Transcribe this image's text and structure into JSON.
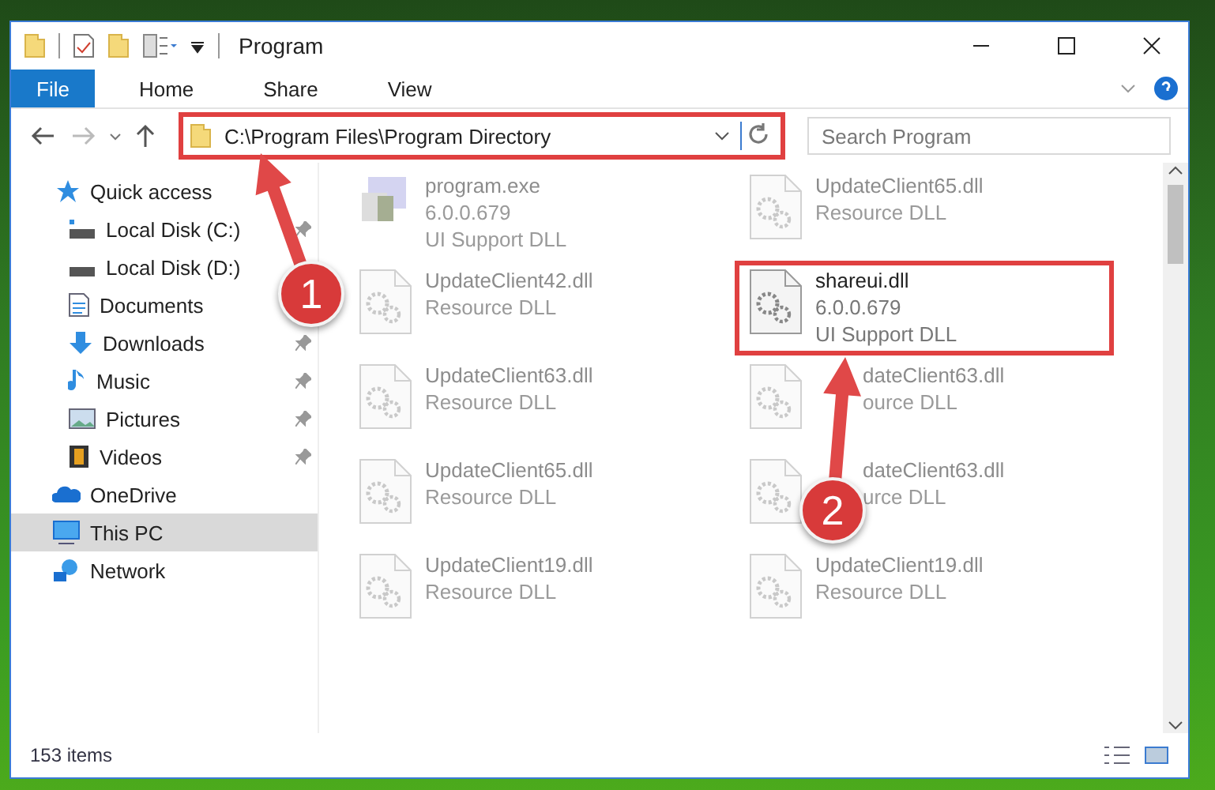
{
  "window": {
    "title": "Program"
  },
  "ribbon_tabs": [
    {
      "label": "File",
      "selected": true
    },
    {
      "label": "Home",
      "selected": false
    },
    {
      "label": "Share",
      "selected": false
    },
    {
      "label": "View",
      "selected": false
    }
  ],
  "address": {
    "value": "C:\\Program Files\\Program Directory",
    "highlighted": true
  },
  "search": {
    "placeholder": "Search Program"
  },
  "sidebar": {
    "items": [
      {
        "label": "Quick access",
        "selected": false,
        "children": [
          {
            "label": "Local Disk (C:)",
            "pinned": true
          },
          {
            "label": "Local Disk (D:)",
            "pinned": false
          },
          {
            "label": "Documents",
            "pinned": false
          },
          {
            "label": "Downloads",
            "pinned": true
          },
          {
            "label": "Music",
            "pinned": true
          },
          {
            "label": "Pictures",
            "pinned": true
          },
          {
            "label": "Videos",
            "pinned": true
          }
        ]
      },
      {
        "label": "OneDrive",
        "selected": false
      },
      {
        "label": "This PC",
        "selected": true
      },
      {
        "label": "Network",
        "selected": false
      }
    ]
  },
  "files": [
    {
      "kind": "exe",
      "name": "program.exe",
      "lines": [
        "6.0.0.679",
        "UI Support DLL"
      ],
      "highlighted": false
    },
    {
      "kind": "dll",
      "name": "UpdateClient65.dll",
      "lines": [
        "Resource DLL"
      ],
      "highlighted": false
    },
    {
      "kind": "dll",
      "name": "UpdateClient42.dll",
      "lines": [
        "Resource DLL"
      ],
      "highlighted": false
    },
    {
      "kind": "dll",
      "name": "shareui.dll",
      "lines": [
        "6.0.0.679",
        "UI Support DLL"
      ],
      "highlighted": true
    },
    {
      "kind": "dll",
      "name": "UpdateClient63.dll",
      "lines": [
        "Resource DLL"
      ],
      "highlighted": false
    },
    {
      "kind": "dll",
      "name": "dateClient63.dll",
      "lines": [
        "ource DLL"
      ],
      "highlighted": false,
      "covered": true
    },
    {
      "kind": "dll",
      "name": "UpdateClient65.dll",
      "lines": [
        "Resource DLL"
      ],
      "highlighted": false
    },
    {
      "kind": "dll",
      "name": "dateClient63.dll",
      "lines": [
        "urce DLL"
      ],
      "highlighted": false,
      "covered": true
    },
    {
      "kind": "dll",
      "name": "UpdateClient19.dll",
      "lines": [
        "Resource DLL"
      ],
      "highlighted": false
    },
    {
      "kind": "dll",
      "name": "UpdateClient19.dll",
      "lines": [
        "Resource DLL"
      ],
      "highlighted": false
    }
  ],
  "status_bar": {
    "count": "153 items"
  },
  "annotations": [
    {
      "label": "1"
    },
    {
      "label": "2"
    }
  ]
}
